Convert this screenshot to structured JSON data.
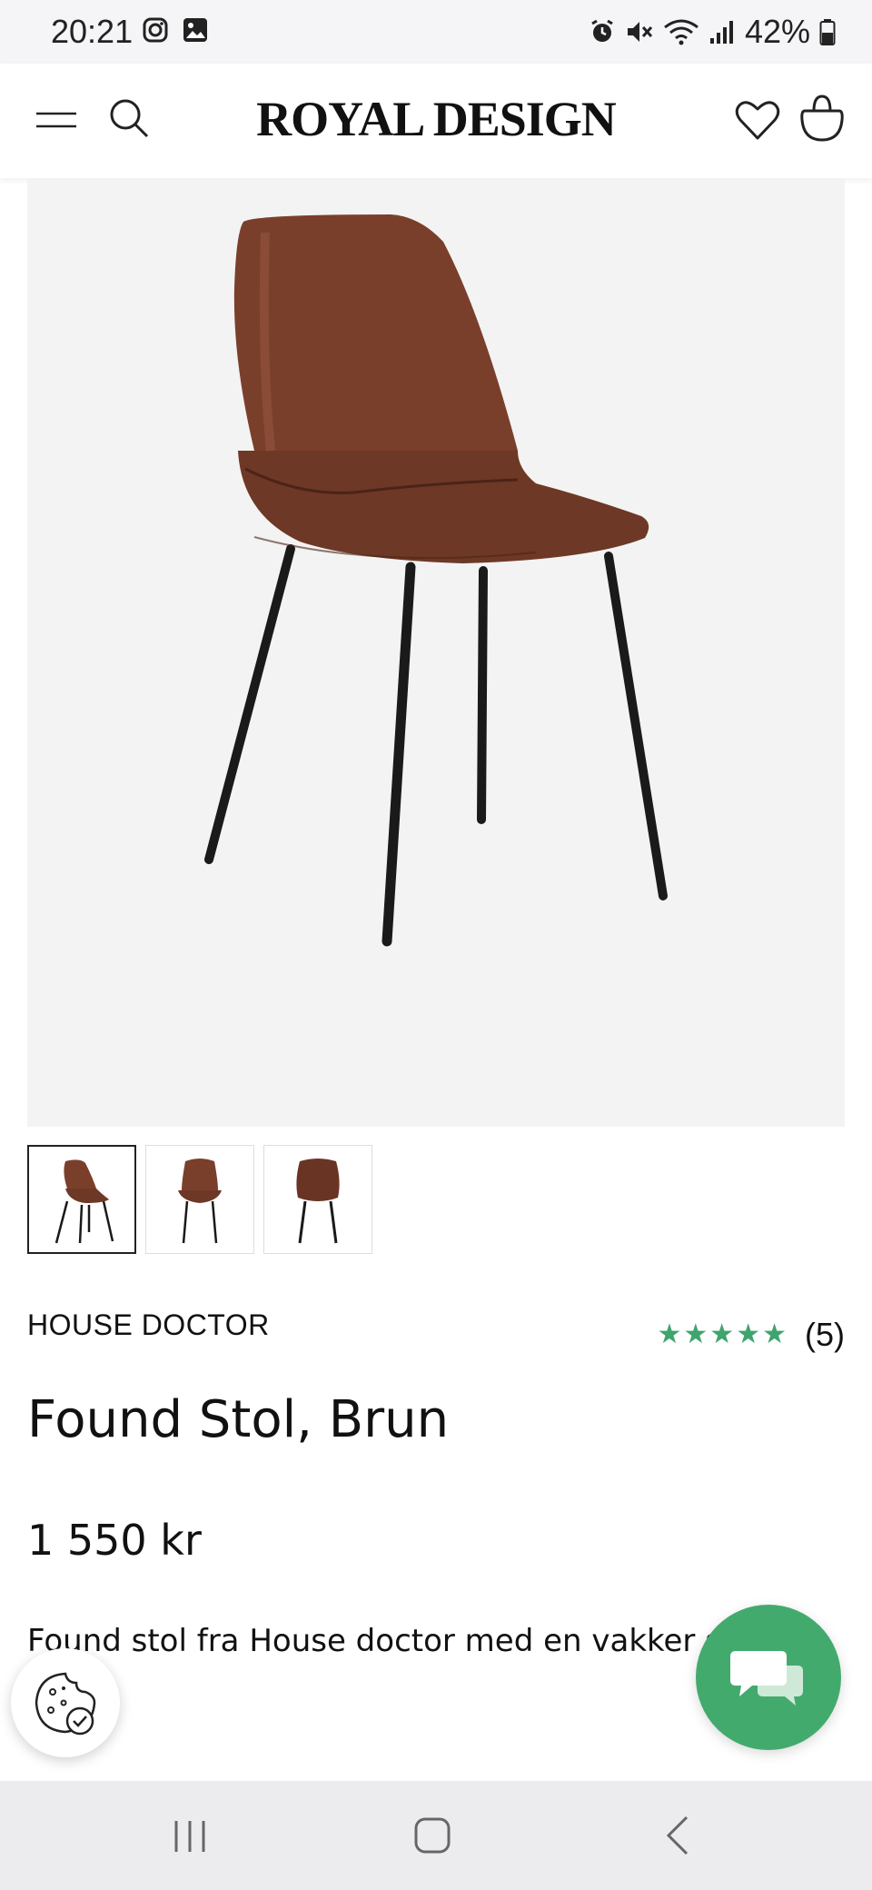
{
  "status_bar": {
    "time": "20:21",
    "battery": "42%",
    "left_icons": [
      "instagram-icon",
      "gallery-icon"
    ],
    "right_icons": [
      "alarm-icon",
      "mute-icon",
      "wifi-icon",
      "signal-icon",
      "battery-icon"
    ]
  },
  "header": {
    "logo": "ROYAL DESIGN",
    "icons": [
      "menu-icon",
      "search-icon",
      "heart-icon",
      "bag-icon"
    ]
  },
  "gallery": {
    "selected_index": 0,
    "thumbnail_count": 3
  },
  "product": {
    "brand": "HOUSE DOCTOR",
    "rating_stars": 5,
    "review_count": "(5)",
    "name": "Found Stol, Brun",
    "price": "1 550 kr",
    "description_preview": "Found stol fra House doctor med en vakker s"
  },
  "colors": {
    "accent_green": "#43aa6e",
    "star_green": "#3fa46d",
    "chair_brown": "#7a3f2b"
  }
}
